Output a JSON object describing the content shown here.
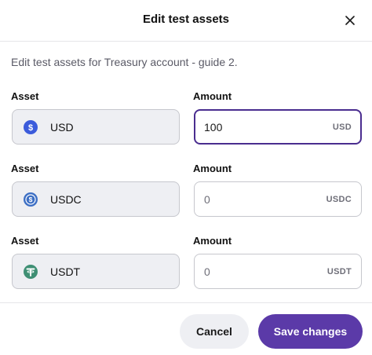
{
  "dialog": {
    "title": "Edit test assets",
    "description": "Edit test assets for Treasury account - guide 2."
  },
  "rows": [
    {
      "asset_label": "Asset",
      "amount_label": "Amount",
      "asset": "USD",
      "amount_value": "100",
      "amount_unit": "USD",
      "icon": "dollar-coin-icon",
      "icon_color": "#3b5bdb"
    },
    {
      "asset_label": "Asset",
      "amount_label": "Amount",
      "asset": "USDC",
      "amount_placeholder": "0",
      "amount_unit": "USDC",
      "icon": "usdc-coin-icon",
      "icon_color": "#3d6fc4"
    },
    {
      "asset_label": "Asset",
      "amount_label": "Amount",
      "asset": "USDT",
      "amount_placeholder": "0",
      "amount_unit": "USDT",
      "icon": "tether-coin-icon",
      "icon_color": "#3f8f74"
    }
  ],
  "buttons": {
    "cancel": "Cancel",
    "save": "Save changes"
  },
  "colors": {
    "accent": "#5b3aa8",
    "focus_border": "#4a2d8f"
  }
}
